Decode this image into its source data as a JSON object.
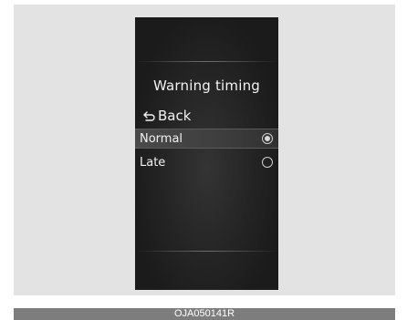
{
  "screen": {
    "title": "Warning timing",
    "back_label": "Back",
    "options": [
      {
        "label": "Normal",
        "selected": true
      },
      {
        "label": "Late",
        "selected": false
      }
    ]
  },
  "caption": "OJA050141R",
  "icons": {
    "back": "back-arrow-icon",
    "radio_on": "radio-selected-icon",
    "radio_off": "radio-unselected-icon"
  }
}
